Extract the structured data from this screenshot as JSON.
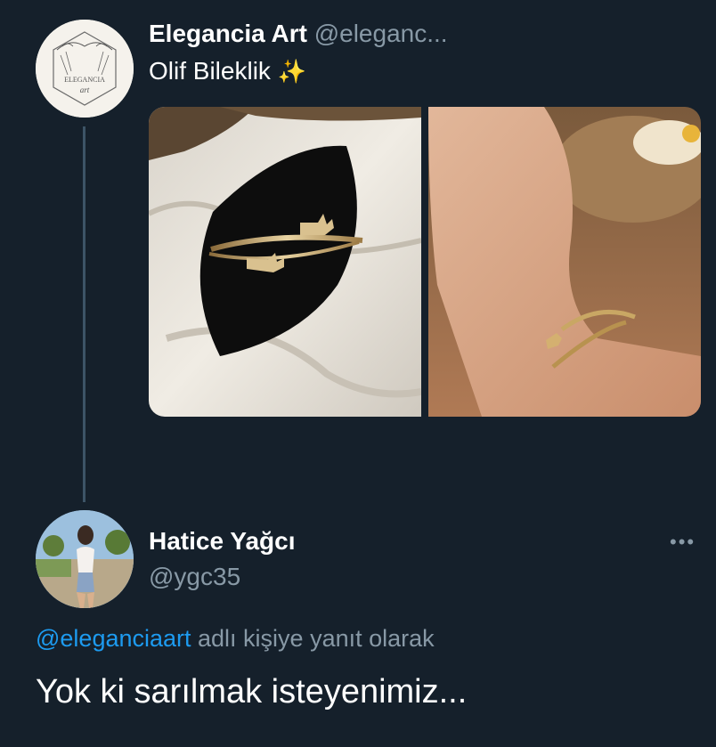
{
  "tweet": {
    "author_name": "Elegancia Art",
    "author_handle": "@eleganc...",
    "avatar_logo_text": "ELEGANCIA art",
    "text": "Olif Bileklik",
    "sparkle_icon": "sparkles-emoji",
    "media": [
      {
        "name": "bracelet-on-velvet-photo"
      },
      {
        "name": "bracelet-on-wrist-photo"
      }
    ]
  },
  "reply": {
    "author_name": "Hatice Yağcı",
    "author_handle": "@ygc35",
    "more_label": "•••",
    "context_mention": "@eleganciaart",
    "context_suffix": " adlı kişiye yanıt olarak",
    "text": "Yok ki sarılmak isteyenimiz..."
  },
  "colors": {
    "background": "#15202b",
    "secondary_text": "#8899a6",
    "link": "#1d9bf0",
    "thread_line": "#3d5466"
  }
}
